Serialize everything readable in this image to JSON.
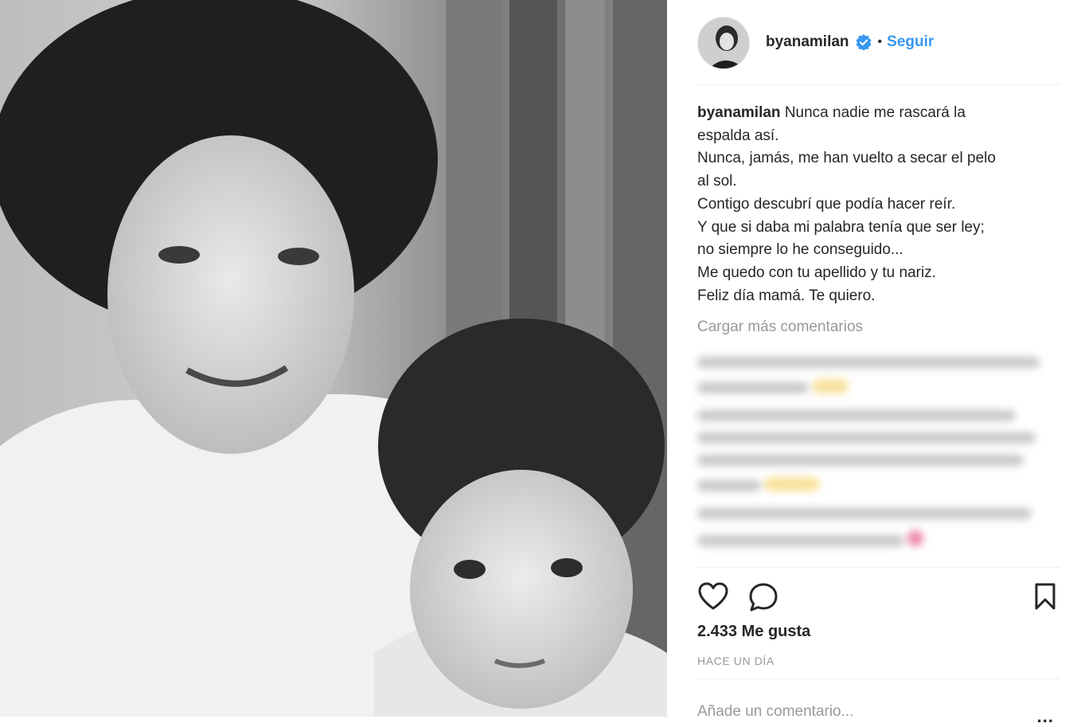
{
  "post": {
    "image_alt": "Black and white photo of a woman holding a young child",
    "header": {
      "username": "byanamilan",
      "separator": "•",
      "follow_label": "Seguir"
    },
    "caption": {
      "username": "byanamilan",
      "lines": [
        "Nunca nadie me rascará la",
        "espalda así.",
        "Nunca, jamás, me han vuelto a secar el pelo",
        "al sol.",
        "Contigo descubrí que podía hacer reír.",
        "Y que si daba mi palabra tenía que ser ley;",
        "no siempre lo he conseguido...",
        "Me quedo con tu apellido y tu nariz.",
        "Feliz día mamá. Te quiero."
      ]
    },
    "load_more_label": "Cargar más comentarios",
    "likes_label": "2.433 Me gusta",
    "timestamp": "HACE UN DÍA",
    "comment_placeholder": "Añade un comentario...",
    "more_options": "..."
  },
  "icons": {
    "verified": "verified-badge-icon",
    "like": "heart-icon",
    "comment": "comment-icon",
    "save": "bookmark-icon",
    "options": "more-options-icon"
  },
  "colors": {
    "accent": "#3897f0",
    "text": "#262626",
    "muted": "#999999",
    "divider": "#efefef"
  }
}
